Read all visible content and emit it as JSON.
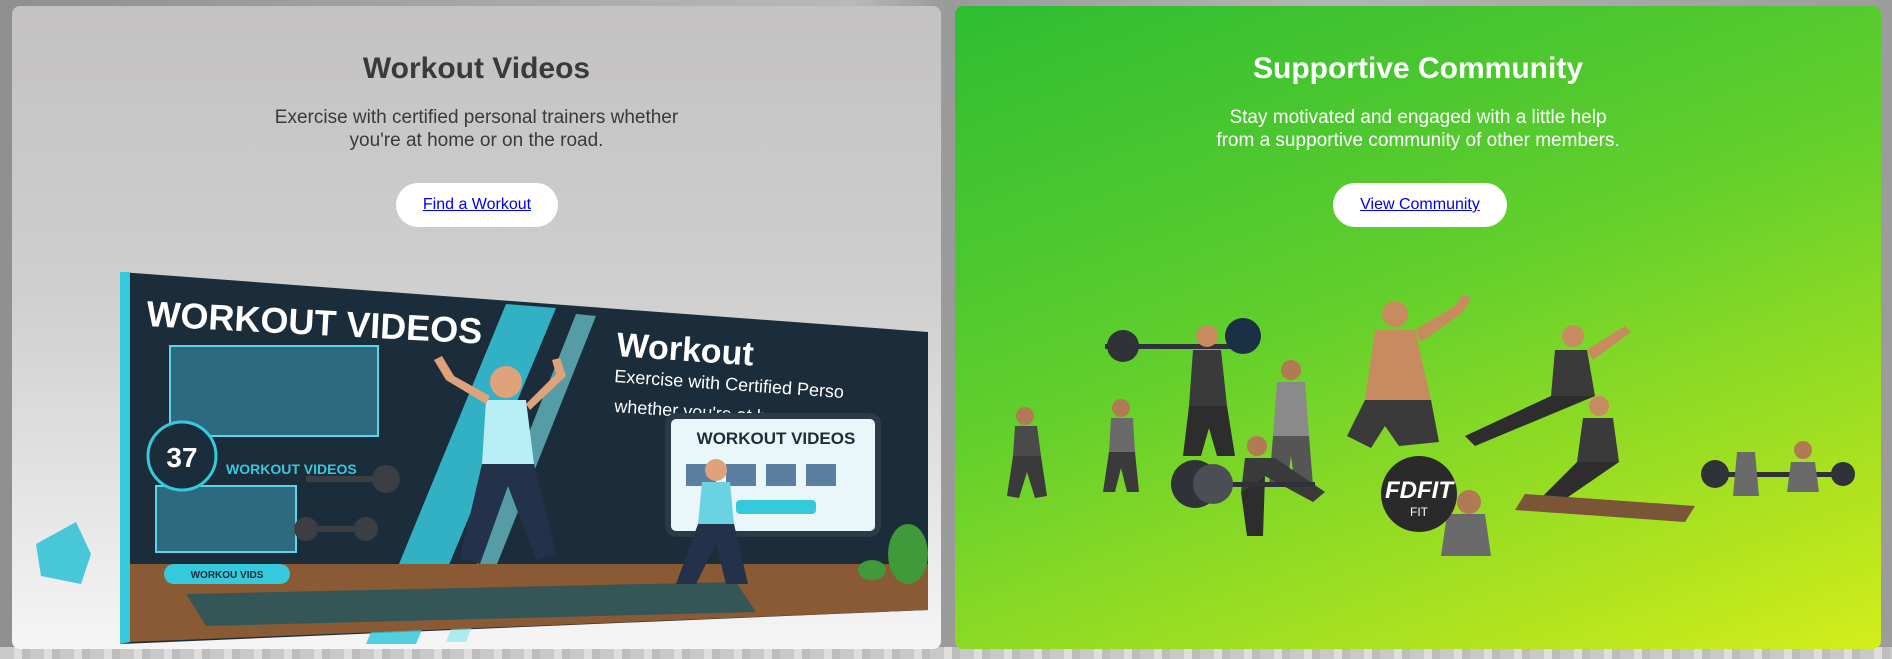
{
  "cards": {
    "workout": {
      "title": "Workout Videos",
      "description_line1": "Exercise with certified personal trainers whether",
      "description_line2": "you're at home or on the road.",
      "cta_label": "Find a Workout",
      "image": {
        "headline": "WORKOUT VIDEOS",
        "side_title": "Workout",
        "side_line1": "Exercise with Certified Perso",
        "side_line2": "whether you're at home road",
        "badge_number": "37",
        "badge_label": "WORKOUT VIDEOS",
        "screen_title": "WORKOUT VIDEOS",
        "footer_label": "WORKOU VIDS"
      }
    },
    "community": {
      "title": "Supportive Community",
      "description_line1": "Stay motivated and engaged with a little help",
      "description_line2": "from a supportive community of other members.",
      "cta_label": "View Community",
      "image": {
        "logo_text": "FDFIT",
        "logo_subtext": "FIT"
      }
    }
  },
  "colors": {
    "link": "#0000ee",
    "community_green": "#2ebd33",
    "community_lime": "#d4ee1c",
    "accent_cyan": "#3ad3e3"
  }
}
